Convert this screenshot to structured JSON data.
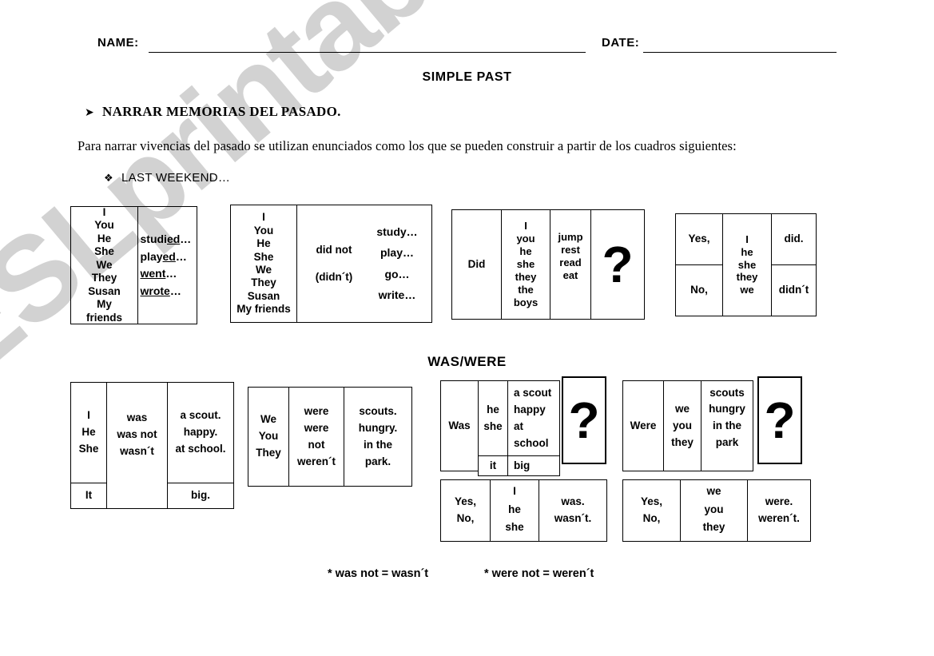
{
  "header": {
    "name_label": "NAME:",
    "date_label": "DATE:",
    "title": "SIMPLE PAST",
    "objective_bullet": "➤",
    "objective": "NARRAR MEMORIAS DEL PASADO.",
    "intro": "Para narrar vivencias del pasado se utilizan enunciados como los  que se pueden construir a partir de los cuadros siguientes:",
    "section_bullet": "❖",
    "section_last_weekend": "LAST WEEKEND…",
    "section_was_were": "WAS/WERE"
  },
  "watermark": "ESLprintables.com",
  "tables": {
    "affirmative": {
      "subjects": [
        "I",
        "You",
        "He",
        "She",
        "We",
        "They",
        "Susan",
        "My",
        "friends"
      ],
      "verbs": [
        {
          "stem": "studi",
          "suffix": "ed",
          "tail": "…"
        },
        {
          "stem": "play",
          "suffix": "ed",
          "tail": "…"
        },
        {
          "stem": "",
          "suffix": "went",
          "tail": "…"
        },
        {
          "stem": "",
          "suffix": "wrote",
          "tail": "…"
        }
      ]
    },
    "negative": {
      "subjects": [
        "I",
        "You",
        "He",
        "She",
        "We",
        "They",
        "Susan",
        "My friends"
      ],
      "aux": [
        "did not",
        "(didn´t)"
      ],
      "verbs": [
        "study…",
        "play…",
        "go…",
        "write…"
      ]
    },
    "interrogative": {
      "aux": "Did",
      "subjects": [
        "I",
        "you",
        "he",
        "she",
        "they",
        "the",
        "boys"
      ],
      "verbs": [
        "jump",
        "rest",
        "read",
        "eat"
      ],
      "question_mark": "?"
    },
    "short_answers_did": {
      "yes": "Yes,",
      "no": "No,",
      "subjects": [
        "I",
        "he",
        "she",
        "they",
        "we"
      ],
      "affirmative": "did.",
      "negative": "didn´t"
    },
    "was_statement": {
      "subjects": [
        "I",
        "He",
        "She"
      ],
      "subject_extra": "It",
      "verbs": [
        "was",
        "was not",
        "wasn´t"
      ],
      "complements": [
        "a scout.",
        "happy.",
        "at school."
      ],
      "complement_extra": "big."
    },
    "were_statement": {
      "subjects": [
        "We",
        "You",
        "They"
      ],
      "verbs": [
        "were",
        "were",
        "not",
        "weren´t"
      ],
      "complements": [
        "scouts.",
        "hungry.",
        "in the",
        "park."
      ]
    },
    "was_question": {
      "aux": "Was",
      "subjects": [
        "he",
        "she"
      ],
      "subject_extra": "it",
      "complements": [
        "a scout",
        "happy",
        "at",
        "school"
      ],
      "complement_extra": "big",
      "question_mark": "?"
    },
    "were_question": {
      "aux": "Were",
      "subjects": [
        "we",
        "you",
        "they"
      ],
      "complements": [
        "scouts",
        "hungry",
        "in the",
        "park"
      ],
      "question_mark": "?"
    },
    "short_answers_was": {
      "yes": "Yes,",
      "no": "No,",
      "subjects": [
        "I",
        "he",
        "she"
      ],
      "affirmative": "was.",
      "negative": "wasn´t."
    },
    "short_answers_were": {
      "yes": "Yes,",
      "no": "No,",
      "subjects": [
        "we",
        "you",
        "they"
      ],
      "affirmative": "were.",
      "negative": "weren´t."
    }
  },
  "footnotes": {
    "was": "* was not = wasn´t",
    "were": "* were not = weren´t"
  }
}
